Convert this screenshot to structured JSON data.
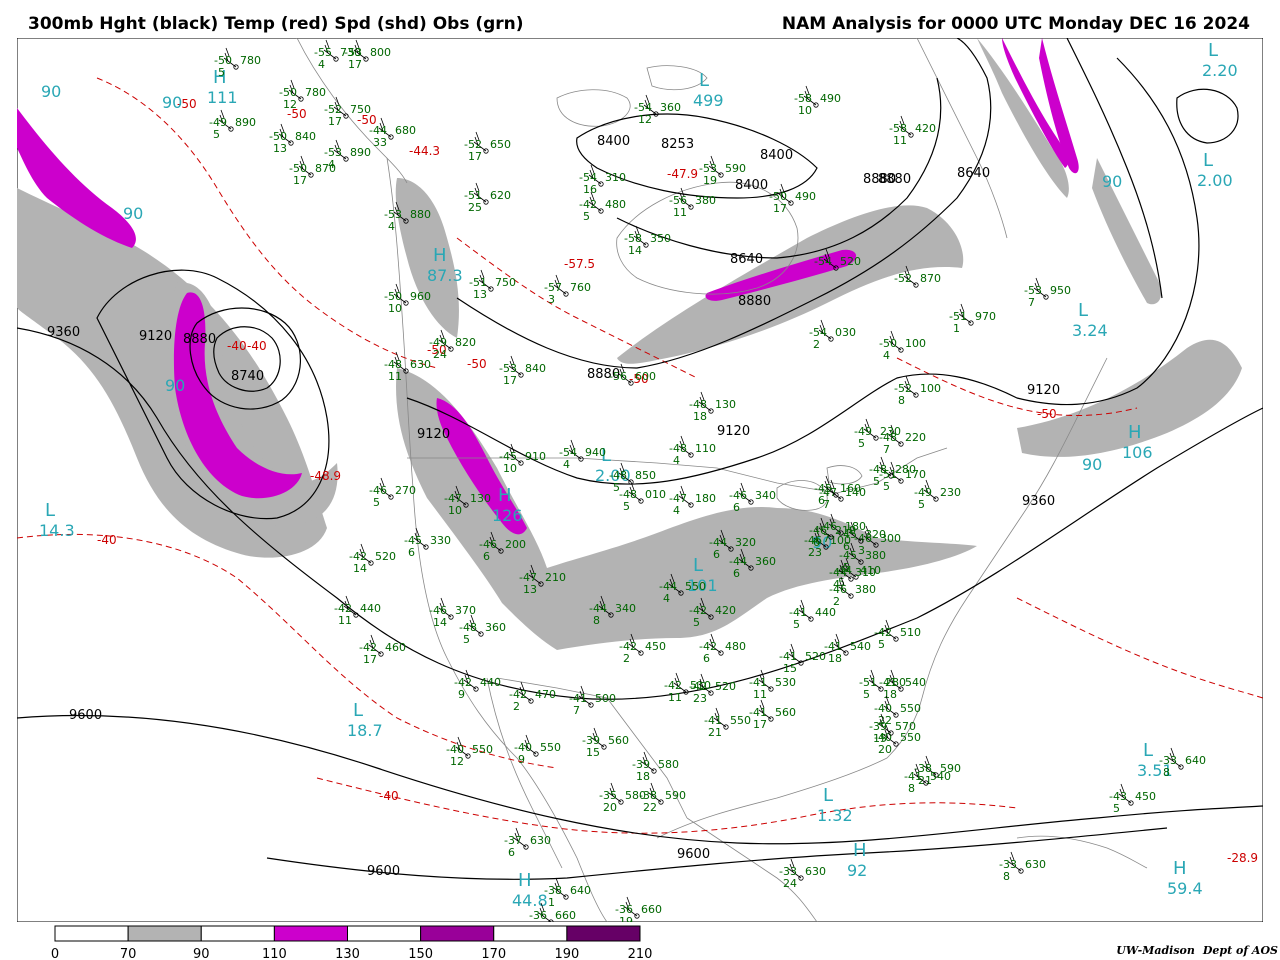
{
  "header": {
    "left_title": "300mb Hght (black) Temp (red) Spd (shd) Obs (grn)",
    "right_title": "NAM Analysis for 0000 UTC Monday  DEC 16 2024"
  },
  "colors": {
    "height_contour": "#000000",
    "temp_contour": "#cc0000",
    "speed_70_90": "#b3b3b3",
    "speed_110_130": "#cc00cc",
    "speed_150_170": "#990099",
    "speed_190_210": "#660066",
    "obs": "#006600",
    "extrema": "#2aa7b5",
    "map_lines": "#888888"
  },
  "height_labels": [
    "9360",
    "9120",
    "8880",
    "8740",
    "8400",
    "8253",
    "8400",
    "8400",
    "8640",
    "8640",
    "8880",
    "8880",
    "9120",
    "9120",
    "9120",
    "9360",
    "9600",
    "9600",
    "9600",
    "8880",
    "8880"
  ],
  "temp_labels": [
    "-50",
    "-50",
    "-50",
    "-44.3",
    "-57.5",
    "-50",
    "-50",
    "-40",
    "-47.9",
    "-50",
    "-48.9",
    "-40",
    "-40",
    "-28.9",
    "-40",
    "-50"
  ],
  "extrema": [
    {
      "type": "H",
      "value": "111"
    },
    {
      "type": "H",
      "value": "87.3"
    },
    {
      "type": "H",
      "value": "126"
    },
    {
      "type": "L",
      "value": "14.3"
    },
    {
      "type": "L",
      "value": "18.7"
    },
    {
      "type": "L",
      "value": "2.00"
    },
    {
      "type": "L",
      "value": "101"
    },
    {
      "type": "L",
      "value": "1.32"
    },
    {
      "type": "L",
      "value": "3.51"
    },
    {
      "type": "L",
      "value": "3.24"
    },
    {
      "type": "L",
      "value": "2.00"
    },
    {
      "type": "H",
      "value": "106"
    },
    {
      "type": "H",
      "value": "44.8"
    },
    {
      "type": "H",
      "value": "59.4"
    },
    {
      "type": "L",
      "value": "2.20"
    },
    {
      "type": "L",
      "value": "499"
    },
    {
      "type": "H",
      "value": "92"
    }
  ],
  "speed_labels": [
    "90",
    "90",
    "90",
    "90",
    "90",
    "90",
    "90"
  ],
  "stations": [
    {
      "t": "-50",
      "h": "780",
      "d": "5"
    },
    {
      "t": "-55",
      "h": "730",
      "d": "4"
    },
    {
      "t": "-53",
      "h": "800",
      "d": "17"
    },
    {
      "t": "-50",
      "h": "780",
      "d": "12"
    },
    {
      "t": "-52",
      "h": "750",
      "d": "17"
    },
    {
      "t": "-49",
      "h": "890",
      "d": "5"
    },
    {
      "t": "-50",
      "h": "840",
      "d": "13"
    },
    {
      "t": "-44",
      "h": "680",
      "d": "33"
    },
    {
      "t": "-53",
      "h": "890",
      "d": "4"
    },
    {
      "t": "-50",
      "h": "870",
      "d": "17"
    },
    {
      "t": "-52",
      "h": "650",
      "d": "17"
    },
    {
      "t": "-51",
      "h": "620",
      "d": "25"
    },
    {
      "t": "-53",
      "h": "880",
      "d": "4"
    },
    {
      "t": "-51",
      "h": "750",
      "d": "13"
    },
    {
      "t": "-57",
      "h": "760",
      "d": "3"
    },
    {
      "t": "-50",
      "h": "960",
      "d": "10"
    },
    {
      "t": "-49",
      "h": "820",
      "d": "24"
    },
    {
      "t": "-53",
      "h": "840",
      "d": "17"
    },
    {
      "t": "-48",
      "h": "630",
      "d": "11"
    },
    {
      "t": "-56",
      "h": "600",
      "d": ""
    },
    {
      "t": "-48",
      "h": "130",
      "d": "18"
    },
    {
      "t": "-45",
      "h": "910",
      "d": "10"
    },
    {
      "t": "-54",
      "h": "940",
      "d": "4"
    },
    {
      "t": "-48",
      "h": "110",
      "d": "4"
    },
    {
      "t": "-48",
      "h": "850",
      "d": "5"
    },
    {
      "t": "-48",
      "h": "010",
      "d": "5"
    },
    {
      "t": "-47",
      "h": "180",
      "d": "4"
    },
    {
      "t": "-46",
      "h": "340",
      "d": "6"
    },
    {
      "t": "-46",
      "h": "270",
      "d": "5"
    },
    {
      "t": "-47",
      "h": "130",
      "d": "10"
    },
    {
      "t": "-46",
      "h": "200",
      "d": "6"
    },
    {
      "t": "-45",
      "h": "330",
      "d": "6"
    },
    {
      "t": "-48",
      "h": "360",
      "d": "5"
    },
    {
      "t": "-44",
      "h": "320",
      "d": "6"
    },
    {
      "t": "-44",
      "h": "360",
      "d": "6"
    },
    {
      "t": "-44",
      "h": "550",
      "d": "4"
    },
    {
      "t": "-44",
      "h": "340",
      "d": "8"
    },
    {
      "t": "-42",
      "h": "420",
      "d": "5"
    },
    {
      "t": "-41",
      "h": "440",
      "d": "5"
    },
    {
      "t": "-42",
      "h": "440",
      "d": "11"
    },
    {
      "t": "-46",
      "h": "370",
      "d": "14"
    },
    {
      "t": "-42",
      "h": "460",
      "d": "17"
    },
    {
      "t": "-42",
      "h": "440",
      "d": "9"
    },
    {
      "t": "-42",
      "h": "470",
      "d": "2"
    },
    {
      "t": "-41",
      "h": "500",
      "d": "7"
    },
    {
      "t": "-42",
      "h": "450",
      "d": "2"
    },
    {
      "t": "-42",
      "h": "480",
      "d": "6"
    },
    {
      "t": "-41",
      "h": "520",
      "d": "15"
    },
    {
      "t": "-42",
      "h": "510",
      "d": "11"
    },
    {
      "t": "-42",
      "h": "520",
      "d": "23"
    },
    {
      "t": "-41",
      "h": "530",
      "d": "11"
    },
    {
      "t": "-41",
      "h": "550",
      "d": "21"
    },
    {
      "t": "-41",
      "h": "560",
      "d": "17"
    },
    {
      "t": "-41",
      "h": "540",
      "d": "18"
    },
    {
      "t": "-40",
      "h": "550",
      "d": "22"
    },
    {
      "t": "-40",
      "h": "550",
      "d": "20"
    },
    {
      "t": "-39",
      "h": "570",
      "d": "15"
    },
    {
      "t": "-38",
      "h": "590",
      "d": "21"
    },
    {
      "t": "-41",
      "h": "540",
      "d": "8"
    },
    {
      "t": "-40",
      "h": "550",
      "d": "12"
    },
    {
      "t": "-40",
      "h": "550",
      "d": "9"
    },
    {
      "t": "-39",
      "h": "560",
      "d": "15"
    },
    {
      "t": "-39",
      "h": "580",
      "d": "18"
    },
    {
      "t": "-35",
      "h": "580",
      "d": "20"
    },
    {
      "t": "-38",
      "h": "590",
      "d": "22"
    },
    {
      "t": "-37",
      "h": "630",
      "d": "6"
    },
    {
      "t": "-38",
      "h": "640",
      "d": "1"
    },
    {
      "t": "-36",
      "h": "660",
      "d": ""
    },
    {
      "t": "-36",
      "h": "660",
      "d": "19"
    },
    {
      "t": "-33",
      "h": "630",
      "d": "24"
    },
    {
      "t": "-33",
      "h": "630",
      "d": "8"
    },
    {
      "t": "-33",
      "h": "640",
      "d": "8"
    },
    {
      "t": "-43",
      "h": "450",
      "d": "5"
    },
    {
      "t": "-44",
      "h": "410",
      "d": "5"
    },
    {
      "t": "-46",
      "h": "380",
      "d": "2"
    },
    {
      "t": "-42",
      "h": "520",
      "d": "14"
    },
    {
      "t": "-42",
      "h": "510",
      "d": "5"
    },
    {
      "t": "-41",
      "h": "540",
      "d": "18"
    },
    {
      "t": "-51",
      "h": "280",
      "d": "5"
    },
    {
      "t": "-49",
      "h": "230",
      "d": "5"
    },
    {
      "t": "-48",
      "h": "280",
      "d": "5"
    },
    {
      "t": "-48",
      "h": "220",
      "d": "7"
    },
    {
      "t": "-49",
      "h": "230",
      "d": "5"
    },
    {
      "t": "-51",
      "h": "170",
      "d": "5"
    },
    {
      "t": "-52",
      "h": "100",
      "d": "8"
    },
    {
      "t": "-50",
      "h": "100",
      "d": "4"
    },
    {
      "t": "-54",
      "h": "030",
      "d": "2"
    },
    {
      "t": "-51",
      "h": "970",
      "d": "1"
    },
    {
      "t": "-53",
      "h": "950",
      "d": "7"
    },
    {
      "t": "-52",
      "h": "870",
      "d": ""
    },
    {
      "t": "-54",
      "h": "520",
      "d": ""
    },
    {
      "t": "-50",
      "h": "490",
      "d": "17"
    },
    {
      "t": "-58",
      "h": "420",
      "d": "11"
    },
    {
      "t": "-58",
      "h": "490",
      "d": "10"
    },
    {
      "t": "-54",
      "h": "310",
      "d": "16"
    },
    {
      "t": "-54",
      "h": "360",
      "d": "12"
    },
    {
      "t": "-53",
      "h": "590",
      "d": "19"
    },
    {
      "t": "-58",
      "h": "350",
      "d": "14"
    },
    {
      "t": "-56",
      "h": "380",
      "d": "11"
    },
    {
      "t": "-42",
      "h": "480",
      "d": "5"
    },
    {
      "t": "-47",
      "h": "140",
      "d": "7"
    },
    {
      "t": "-45",
      "h": "160",
      "d": "6"
    },
    {
      "t": "-46",
      "h": "300",
      "d": "3"
    },
    {
      "t": "-45",
      "h": "320",
      "d": "6"
    },
    {
      "t": "-46",
      "h": "180",
      "d": "7"
    },
    {
      "t": "-46",
      "h": "100",
      "d": "23"
    },
    {
      "t": "-47",
      "h": "210",
      "d": "13"
    },
    {
      "t": "-46",
      "h": "210",
      "d": "6"
    },
    {
      "t": "-45",
      "h": "380",
      "d": "5"
    },
    {
      "t": "-44",
      "h": "310",
      "d": "4"
    }
  ],
  "legend": {
    "ticks": [
      "0",
      "70",
      "90",
      "110",
      "130",
      "150",
      "170",
      "190",
      "210"
    ],
    "levels": [
      0,
      70,
      90,
      110,
      130,
      150,
      170,
      190,
      210
    ],
    "bin_colors": [
      "#ffffff",
      "#b3b3b3",
      "#ffffff",
      "#cc00cc",
      "#ffffff",
      "#990099",
      "#ffffff",
      "#660066"
    ]
  },
  "credit": {
    "institution": "UW-Madison",
    "department": "Dept of AOS"
  }
}
